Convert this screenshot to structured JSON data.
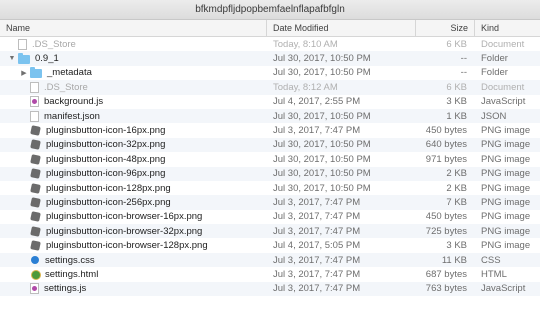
{
  "window": {
    "title": "bfkmdpfljdpopbemfaelnflapafbfgln"
  },
  "columns": {
    "name": "Name",
    "date": "Date Modified",
    "size": "Size",
    "kind": "Kind"
  },
  "rows": [
    {
      "name": ".DS_Store",
      "date": "Today, 8:10 AM",
      "size": "6 KB",
      "kind": "Document",
      "icon": "doc-icon",
      "level": 0,
      "tri": "",
      "dim": true
    },
    {
      "name": "0.9_1",
      "date": "Jul 30, 2017, 10:50 PM",
      "size": "--",
      "kind": "Folder",
      "icon": "folder-icon",
      "level": 0,
      "tri": "▼",
      "dim": false
    },
    {
      "name": "_metadata",
      "date": "Jul 30, 2017, 10:50 PM",
      "size": "--",
      "kind": "Folder",
      "icon": "folder-icon",
      "level": 1,
      "tri": "▶",
      "dim": false
    },
    {
      "name": ".DS_Store",
      "date": "Today, 8:12 AM",
      "size": "6 KB",
      "kind": "Document",
      "icon": "doc-icon",
      "level": 1,
      "tri": "",
      "dim": true
    },
    {
      "name": "background.js",
      "date": "Jul 4, 2017, 2:55 PM",
      "size": "3 KB",
      "kind": "JavaScript",
      "icon": "js-icon",
      "level": 1,
      "tri": "",
      "dim": false
    },
    {
      "name": "manifest.json",
      "date": "Jul 30, 2017, 10:50 PM",
      "size": "1 KB",
      "kind": "JSON",
      "icon": "doc-icon",
      "level": 1,
      "tri": "",
      "dim": false
    },
    {
      "name": "pluginsbutton-icon-16px.png",
      "date": "Jul 3, 2017, 7:47 PM",
      "size": "450 bytes",
      "kind": "PNG image",
      "icon": "png-icon",
      "level": 1,
      "tri": "",
      "dim": false
    },
    {
      "name": "pluginsbutton-icon-32px.png",
      "date": "Jul 30, 2017, 10:50 PM",
      "size": "640 bytes",
      "kind": "PNG image",
      "icon": "png-icon",
      "level": 1,
      "tri": "",
      "dim": false
    },
    {
      "name": "pluginsbutton-icon-48px.png",
      "date": "Jul 30, 2017, 10:50 PM",
      "size": "971 bytes",
      "kind": "PNG image",
      "icon": "png-icon",
      "level": 1,
      "tri": "",
      "dim": false
    },
    {
      "name": "pluginsbutton-icon-96px.png",
      "date": "Jul 30, 2017, 10:50 PM",
      "size": "2 KB",
      "kind": "PNG image",
      "icon": "png-icon",
      "level": 1,
      "tri": "",
      "dim": false
    },
    {
      "name": "pluginsbutton-icon-128px.png",
      "date": "Jul 30, 2017, 10:50 PM",
      "size": "2 KB",
      "kind": "PNG image",
      "icon": "png-icon",
      "level": 1,
      "tri": "",
      "dim": false
    },
    {
      "name": "pluginsbutton-icon-256px.png",
      "date": "Jul 3, 2017, 7:47 PM",
      "size": "7 KB",
      "kind": "PNG image",
      "icon": "png-icon",
      "level": 1,
      "tri": "",
      "dim": false
    },
    {
      "name": "pluginsbutton-icon-browser-16px.png",
      "date": "Jul 3, 2017, 7:47 PM",
      "size": "450 bytes",
      "kind": "PNG image",
      "icon": "png-icon",
      "level": 1,
      "tri": "",
      "dim": false
    },
    {
      "name": "pluginsbutton-icon-browser-32px.png",
      "date": "Jul 3, 2017, 7:47 PM",
      "size": "725 bytes",
      "kind": "PNG image",
      "icon": "png-icon",
      "level": 1,
      "tri": "",
      "dim": false
    },
    {
      "name": "pluginsbutton-icon-browser-128px.png",
      "date": "Jul 4, 2017, 5:05 PM",
      "size": "3 KB",
      "kind": "PNG image",
      "icon": "png-icon",
      "level": 1,
      "tri": "",
      "dim": false
    },
    {
      "name": "settings.css",
      "date": "Jul 3, 2017, 7:47 PM",
      "size": "11 KB",
      "kind": "CSS",
      "icon": "css-icon",
      "level": 1,
      "tri": "",
      "dim": false
    },
    {
      "name": "settings.html",
      "date": "Jul 3, 2017, 7:47 PM",
      "size": "687 bytes",
      "kind": "HTML",
      "icon": "html-icon",
      "level": 1,
      "tri": "",
      "dim": false
    },
    {
      "name": "settings.js",
      "date": "Jul 3, 2017, 7:47 PM",
      "size": "763 bytes",
      "kind": "JavaScript",
      "icon": "js-icon",
      "level": 1,
      "tri": "",
      "dim": false
    }
  ]
}
